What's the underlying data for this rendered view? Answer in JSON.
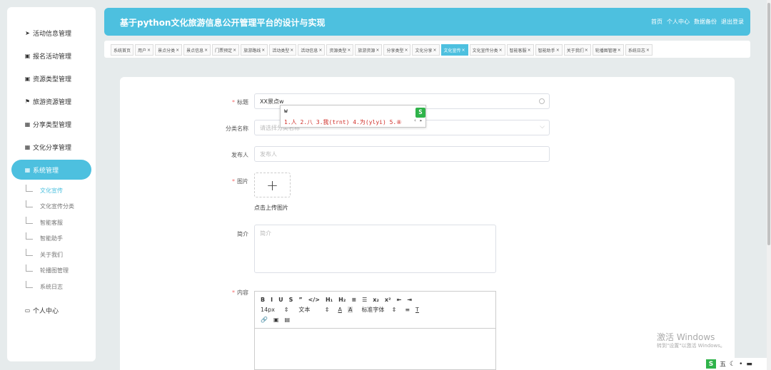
{
  "header": {
    "title": "基于python文化旅游信息公开管理平台的设计与实现",
    "links": [
      "首页",
      "个人中心",
      "数据备份",
      "退出登录"
    ]
  },
  "sidebar": {
    "items": [
      {
        "label": "活动信息管理",
        "icon": "send-icon"
      },
      {
        "label": "报名活动管理",
        "icon": "clipboard-check-icon"
      },
      {
        "label": "资源类型管理",
        "icon": "clipboard-icon"
      },
      {
        "label": "旅游资源管理",
        "icon": "flag-icon"
      },
      {
        "label": "分享类型管理",
        "icon": "grid-icon"
      },
      {
        "label": "文化分享管理",
        "icon": "grid-icon"
      },
      {
        "label": "系统管理",
        "icon": "grid-icon"
      },
      {
        "label": "个人中心",
        "icon": "window-icon"
      }
    ],
    "subitems": [
      "文化宣传",
      "文化宣传分类",
      "智能客服",
      "智能助手",
      "关于我们",
      "轮播图管理",
      "系统日志"
    ]
  },
  "tabs": [
    {
      "label": "系统首页",
      "closable": false
    },
    {
      "label": "用户",
      "closable": true
    },
    {
      "label": "景点分类",
      "closable": true
    },
    {
      "label": "景点信息",
      "closable": true
    },
    {
      "label": "门票预定",
      "closable": true
    },
    {
      "label": "旅游路线",
      "closable": true
    },
    {
      "label": "活动类型",
      "closable": true
    },
    {
      "label": "活动信息",
      "closable": true
    },
    {
      "label": "资源类型",
      "closable": true
    },
    {
      "label": "旅游资源",
      "closable": true
    },
    {
      "label": "分享类型",
      "closable": true
    },
    {
      "label": "文化分享",
      "closable": true
    },
    {
      "label": "文化宣传",
      "closable": true,
      "active": true
    },
    {
      "label": "文化宣传分类",
      "closable": true
    },
    {
      "label": "智能客服",
      "closable": true
    },
    {
      "label": "智能助手",
      "closable": true
    },
    {
      "label": "关于我们",
      "closable": true
    },
    {
      "label": "轮播图管理",
      "closable": true
    },
    {
      "label": "系统日志",
      "closable": true
    }
  ],
  "tab_close": "×",
  "form": {
    "title_label": "标题",
    "title_value": "XX景点w",
    "category_label": "分类名称",
    "category_placeholder": "请选择分类名称",
    "publisher_label": "发布人",
    "publisher_placeholder": "发布人",
    "image_label": "图片",
    "upload_text": "点击上传图片",
    "intro_label": "简介",
    "intro_placeholder": "简介",
    "content_label": "内容",
    "required_mark": "*"
  },
  "editor": {
    "row1": [
      "B",
      "I",
      "U",
      "S",
      "”",
      "</>",
      "H₁",
      "H₂",
      "≡",
      "☰",
      "x₂",
      "x²",
      "⇤",
      "⇥"
    ],
    "font_size": "14px",
    "font_type": "文本",
    "font_family": "标准字体",
    "row3": [
      "🔗",
      "▣",
      "▤"
    ]
  },
  "ime": {
    "composition": "w",
    "candidates": "1.人  2.八  3.我(trnt)  4.为(ylyi)  5.⑧",
    "logo": "S"
  },
  "watermark": {
    "line1": "激活 Windows",
    "line2": "转到\"设置\"以激活 Windows。"
  },
  "tray": {
    "ime_mode": "五",
    "logo": "S"
  }
}
